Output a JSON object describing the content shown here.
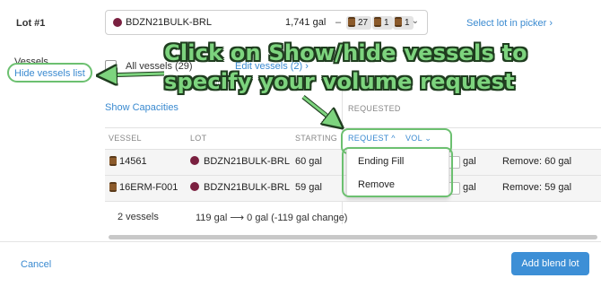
{
  "lot": {
    "label": "Lot #1",
    "selected_name": "BDZN21BULK-BRL",
    "selected_volume": "1,741 gal",
    "dash": "–",
    "chips": [
      "27",
      "1",
      "1"
    ],
    "caret": "⌄",
    "select_in_picker": "Select lot in picker  ›"
  },
  "vessels": {
    "label": "Vessels",
    "hide_list": "Hide vessels list",
    "all_vessels": "All vessels (29)",
    "edit_vessels": "Edit vessels (2)  ›",
    "show_capacities": "Show Capacities",
    "requested": "REQUESTED"
  },
  "table": {
    "headers": {
      "vessel": "VESSEL",
      "lot": "LOT",
      "starting": "STARTING",
      "request": "REQUEST  ^",
      "vol": "VOL  ⌄"
    },
    "rows": [
      {
        "vessel": "14561",
        "lot": "BDZN21BULK-BRL",
        "starting": "60 gal",
        "unit": "gal",
        "remove": "Remove: 60 gal"
      },
      {
        "vessel": "16ERM-F001",
        "lot": "BDZN21BULK-BRL",
        "starting": "59 gal",
        "unit": "gal",
        "remove": "Remove: 59 gal"
      }
    ],
    "summary_count": "2 vessels",
    "summary_change": "119 gal  ⟶  0 gal (-119 gal change)"
  },
  "dropdown": {
    "options": [
      "Ending Fill",
      "Remove"
    ]
  },
  "footer": {
    "cancel": "Cancel",
    "add_blend_lot": "Add blend lot"
  },
  "annotation": {
    "line1": "Click on Show/hide vessels to",
    "line2": "specify your volume request"
  },
  "colors": {
    "accent": "#3a8ad0",
    "button": "#3d8fd6",
    "wine": "#7a2040",
    "highlight_green": "#6cc070"
  }
}
